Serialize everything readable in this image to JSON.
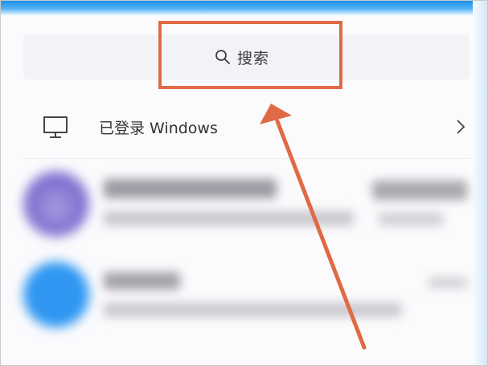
{
  "search": {
    "label": "搜索",
    "icon": "search-icon"
  },
  "account": {
    "label": "已登录 Windows",
    "icon": "monitor-icon"
  },
  "colors": {
    "annotation": "#e06a45",
    "topbar": "#1a8fe8",
    "avatar_purple": "#7f6fd0",
    "avatar_blue": "#2f97f2"
  }
}
